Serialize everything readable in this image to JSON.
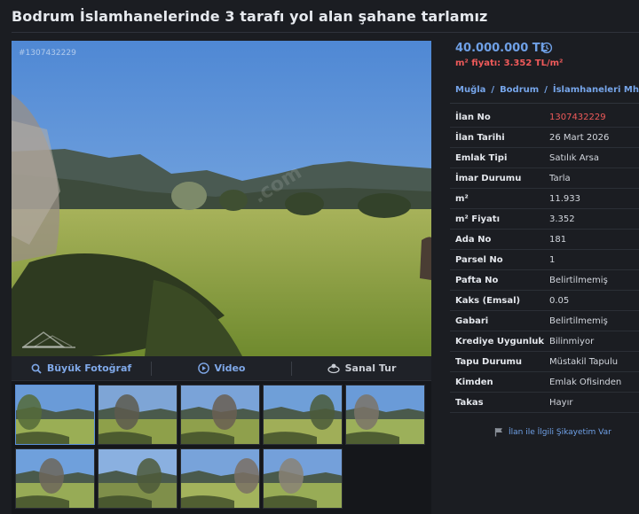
{
  "page": {
    "title": "Bodrum İslamhanelerinde 3 tarafı yol alan şahane tarlamız"
  },
  "gallery": {
    "photo_id": "#1307432229",
    "watermark": ".com",
    "media_buttons": [
      {
        "label": "Büyük Fotoğraf",
        "icon": "magnifier-icon"
      },
      {
        "label": "Video",
        "icon": "play-icon"
      },
      {
        "label": "Sanal Tur",
        "icon": "panorama-icon"
      }
    ],
    "thumbnail_count": 9,
    "active_thumbnail": 1
  },
  "pricing": {
    "price": "40.000.000 TL",
    "m2_price": "m² fiyatı: 3.352 TL/m²"
  },
  "breadcrumb": [
    "Muğla",
    "Bodrum",
    "İslamhaneleri Mh."
  ],
  "details": [
    {
      "key": "İlan No",
      "value": "1307432229",
      "highlight": true
    },
    {
      "key": "İlan Tarihi",
      "value": "26 Mart 2026"
    },
    {
      "key": "Emlak Tipi",
      "value": "Satılık Arsa"
    },
    {
      "key": "İmar Durumu",
      "value": "Tarla"
    },
    {
      "key": "m²",
      "value": "11.933"
    },
    {
      "key": "m² Fiyatı",
      "value": "3.352"
    },
    {
      "key": "Ada No",
      "value": "181"
    },
    {
      "key": "Parsel No",
      "value": "1"
    },
    {
      "key": "Pafta No",
      "value": "Belirtilmemiş"
    },
    {
      "key": "Kaks (Emsal)",
      "value": "0.05"
    },
    {
      "key": "Gabari",
      "value": "Belirtilmemiş"
    },
    {
      "key": "Krediye Uygunluk",
      "value": "Bilinmiyor"
    },
    {
      "key": "Tapu Durumu",
      "value": "Müstakil Tapulu"
    },
    {
      "key": "Kimden",
      "value": "Emlak Ofisinden"
    },
    {
      "key": "Takas",
      "value": "Hayır"
    }
  ],
  "complaint": {
    "label": "İlan ile İlgili Şikayetim Var"
  },
  "colors": {
    "accent_blue": "#6fa0e6",
    "price_red": "#ef5a5a",
    "background": "#1b1d22"
  }
}
